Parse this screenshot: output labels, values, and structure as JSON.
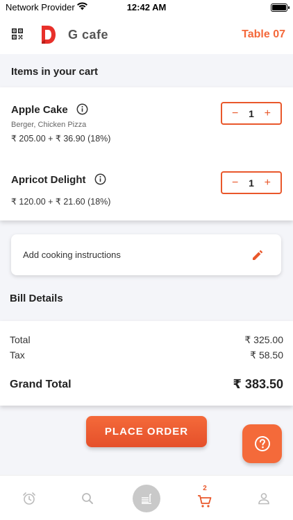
{
  "status_bar": {
    "carrier": "Network Provider",
    "time": "12:42 AM"
  },
  "header": {
    "cafe_name": "G cafe",
    "table_label": "Table 07"
  },
  "cart": {
    "title": "Items in your cart",
    "items": [
      {
        "name": "Apple Cake",
        "description": "Berger, Chicken Pizza",
        "price": "₹ 205.00 + ₹ 36.90 (18%)",
        "quantity": "1"
      },
      {
        "name": "Apricot Delight",
        "description": "",
        "price": "₹ 120.00 + ₹ 21.60 (18%)",
        "quantity": "1"
      }
    ],
    "minus_symbol": "−",
    "plus_symbol": "+"
  },
  "cooking": {
    "label": "Add cooking instructions"
  },
  "bill": {
    "title": "Bill Details",
    "total_label": "Total",
    "total_value": "₹ 325.00",
    "tax_label": "Tax",
    "tax_value": "₹ 58.50",
    "grand_label": "Grand Total",
    "grand_value": "₹ 383.50"
  },
  "actions": {
    "place_order": "PLACE ORDER"
  },
  "bottom_nav": {
    "cart_count": "2",
    "icons": [
      "alarm-icon",
      "search-icon",
      "menu-icon",
      "cart-icon",
      "profile-icon"
    ]
  },
  "colors": {
    "accent": "#f4683a",
    "accent_dark": "#e9572a"
  }
}
